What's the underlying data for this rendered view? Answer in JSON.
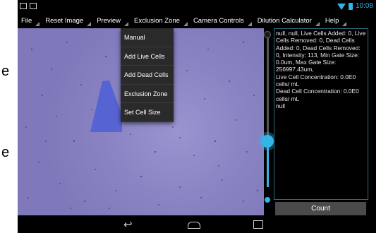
{
  "outer": {
    "left_char_1": "e",
    "left_char_2": "e"
  },
  "statusbar": {
    "time": "10:08"
  },
  "menubar": {
    "items": [
      "File",
      "Reset Image",
      "Preview",
      "Exclusion Zone",
      "Camera Controls",
      "Dilution Calculator",
      "Help"
    ]
  },
  "dropdown": {
    "items": [
      "Manual",
      "Add Live Cells",
      "Add Dead Cells",
      "Exclusion Zone",
      "Set Cell Size"
    ]
  },
  "info": {
    "lines": [
      "null, null, Live Cells Added: 0, Live Cells Removed: 0, Dead Cells Added: 0, Dead Cells Removed: 0, Intensity: 113, Min Gate Size: 0.0um, Max Gate Size: 256997.43um,",
      "Live Cell Concentration: 0.0E0 cells/ mL",
      "Dead Cell Concentration: 0.0E0 cells/ mL",
      "null"
    ]
  },
  "count_button": {
    "label": "Count"
  },
  "colors": {
    "accent": "#33b5e5",
    "image_background": "#8a84c4",
    "dead_zone": "#4a5bd6"
  }
}
